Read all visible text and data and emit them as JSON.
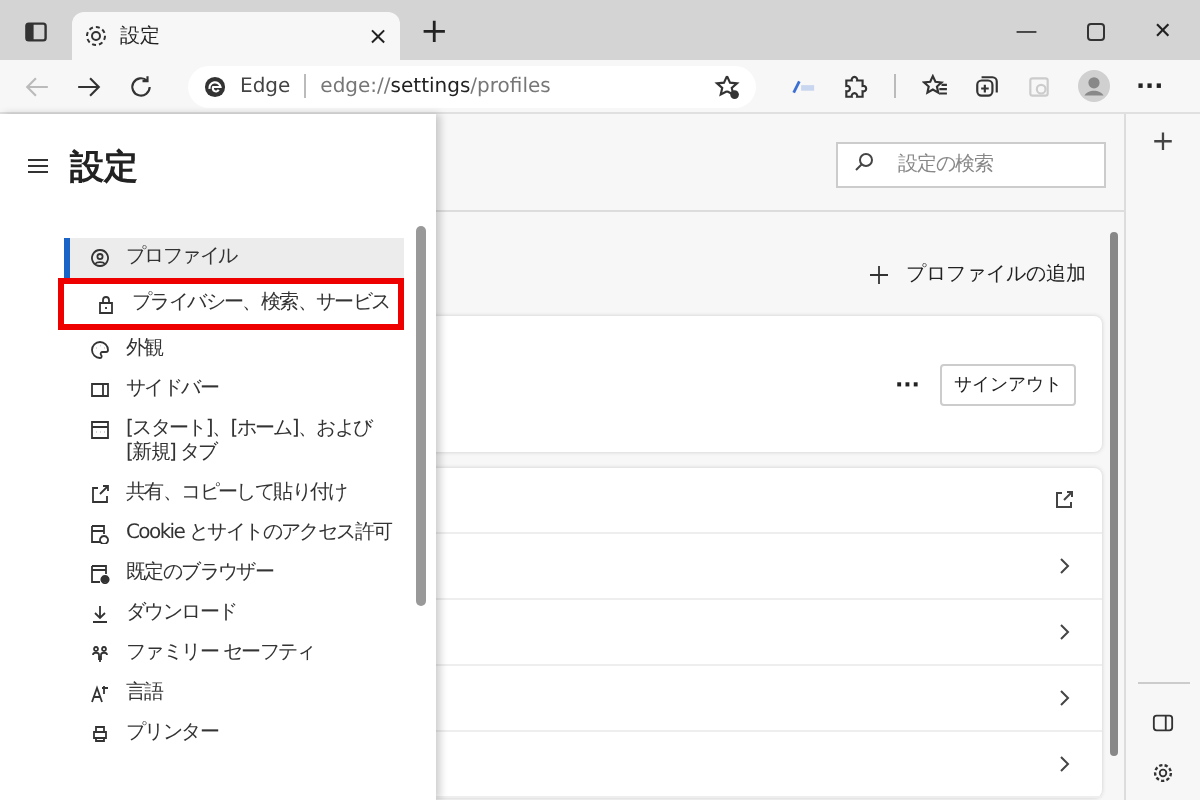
{
  "tab": {
    "title": "設定",
    "close": "×",
    "new_tab": "+"
  },
  "window_controls": {
    "minimize": "—",
    "close": "✕"
  },
  "toolbar": {
    "site_label": "Edge",
    "url": "edge://**settings**/profiles",
    "more": "···"
  },
  "settings_menu": {
    "title": "設定",
    "items": [
      {
        "label": "プロファイル",
        "selected": true,
        "highlighted": false
      },
      {
        "label": "プライバシー、検索、サービス",
        "selected": false,
        "highlighted": true
      },
      {
        "label": "外観",
        "selected": false,
        "highlighted": false
      },
      {
        "label": "サイドバー",
        "selected": false,
        "highlighted": false
      },
      {
        "label": "[スタート]、[ホーム]、および [新規] タブ",
        "selected": false,
        "highlighted": false
      },
      {
        "label": "共有、コピーして貼り付け",
        "selected": false,
        "highlighted": false
      },
      {
        "label": "Cookie とサイトのアクセス許可",
        "selected": false,
        "highlighted": false
      },
      {
        "label": "既定のブラウザー",
        "selected": false,
        "highlighted": false
      },
      {
        "label": "ダウンロード",
        "selected": false,
        "highlighted": false
      },
      {
        "label": "ファミリー セーフティ",
        "selected": false,
        "highlighted": false
      },
      {
        "label": "言語",
        "selected": false,
        "highlighted": false
      },
      {
        "label": "プリンター",
        "selected": false,
        "highlighted": false
      }
    ]
  },
  "search": {
    "placeholder": "設定の検索"
  },
  "add_profile": "プロファイルの追加",
  "profile_card": {
    "more": "···",
    "sign_out": "サインアウト"
  },
  "list_rows": [
    {
      "kind": "external"
    },
    {
      "kind": "chevron"
    },
    {
      "kind": "chevron"
    },
    {
      "kind": "chevron"
    },
    {
      "kind": "chevron"
    }
  ],
  "side_strip": {
    "add": "+"
  }
}
